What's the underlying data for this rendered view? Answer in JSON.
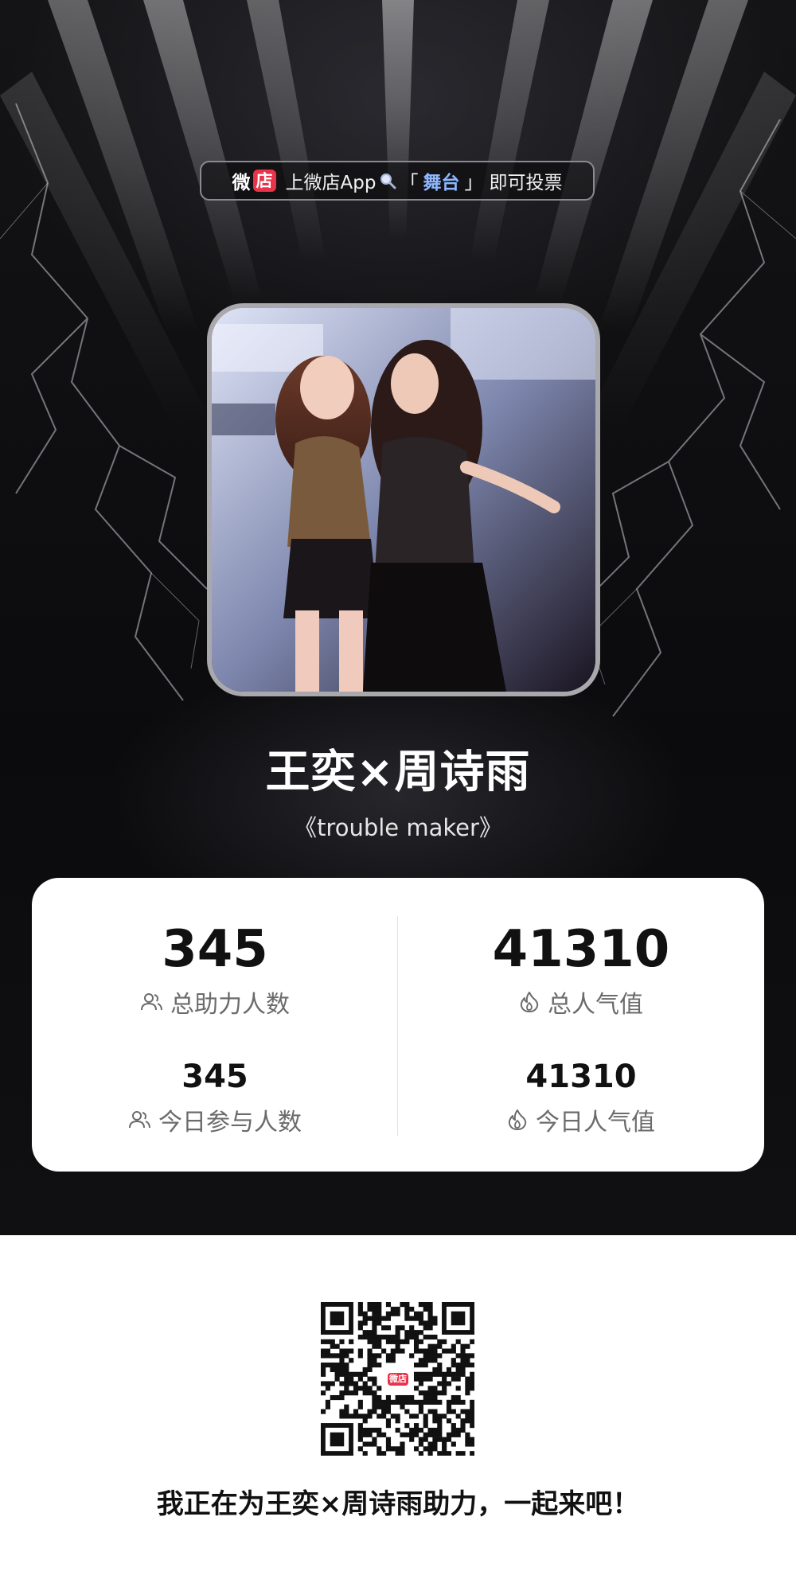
{
  "banner": {
    "logo_text_1": "微",
    "logo_text_2": "店",
    "prefix": "上微店App",
    "open_bracket": "「",
    "keyword": "舞台",
    "close_bracket": "」",
    "suffix": "即可投票"
  },
  "performance": {
    "artists": "王奕×周诗雨",
    "song": "《trouble maker》"
  },
  "stats": {
    "total_supporters": {
      "value": "345",
      "label": "总助力人数",
      "icon": "people-icon"
    },
    "total_popularity": {
      "value": "41310",
      "label": "总人气值",
      "icon": "flame-icon"
    },
    "today_participants": {
      "value": "345",
      "label": "今日参与人数",
      "icon": "people-icon"
    },
    "today_popularity": {
      "value": "41310",
      "label": "今日人气值",
      "icon": "flame-icon"
    }
  },
  "qr": {
    "center_logo": "微店"
  },
  "footer": {
    "text": "我正在为王奕×周诗雨助力，一起来吧！"
  },
  "colors": {
    "brand_red": "#e8334a",
    "keyword_blue": "#8eb8ff",
    "stage_dark": "#0b0b0d"
  }
}
